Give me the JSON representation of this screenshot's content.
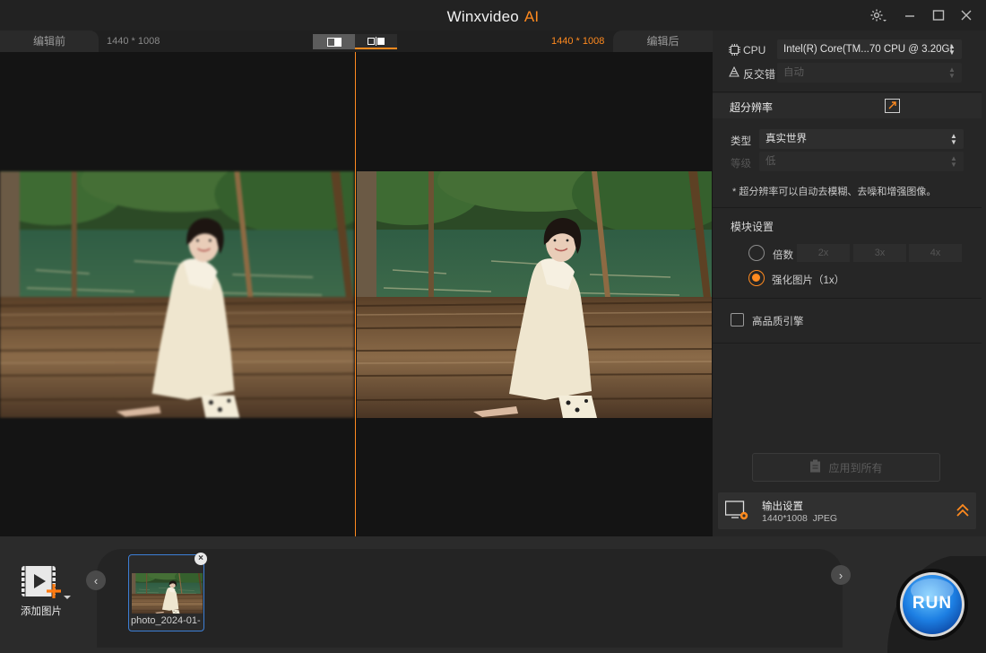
{
  "app": {
    "title": "Winxvideo",
    "title_accent": "AI"
  },
  "window_controls": {
    "settings_icon": "gear-icon",
    "minimize_icon": "minimize-icon",
    "maximize_icon": "maximize-icon",
    "close_icon": "close-icon"
  },
  "preview": {
    "before_label": "编辑前",
    "after_label": "编辑后",
    "before_dims": "1440 * 1008",
    "after_dims": "1440 * 1008"
  },
  "panel": {
    "cpu_label": "CPU",
    "cpu_value": "Intel(R) Core(TM...70 CPU @ 3.20GI",
    "deinterlace_label": "反交错",
    "deinterlace_value": "自动",
    "super_res_title": "超分辨率",
    "type_label": "类型",
    "type_value": "真实世界",
    "level_label": "等级",
    "level_value": "低",
    "note": "* 超分辨率可以自动去模糊、去噪和增强图像。",
    "module_title": "模块设置",
    "scale_label": "倍数",
    "scale_options": [
      "2x",
      "3x",
      "4x"
    ],
    "enhance_label": "强化图片（1x）",
    "hq_engine_label": "高品质引擎",
    "apply_all_label": "应用到所有",
    "output_title": "输出设置",
    "output_resolution": "1440*1008",
    "output_format": "JPEG"
  },
  "bottom": {
    "add_label": "添加图片",
    "thumbnail_name": "photo_2024-01-",
    "run_label": "RUN"
  },
  "colors": {
    "accent": "#ff8a1f",
    "selection": "#3d7fd6"
  }
}
